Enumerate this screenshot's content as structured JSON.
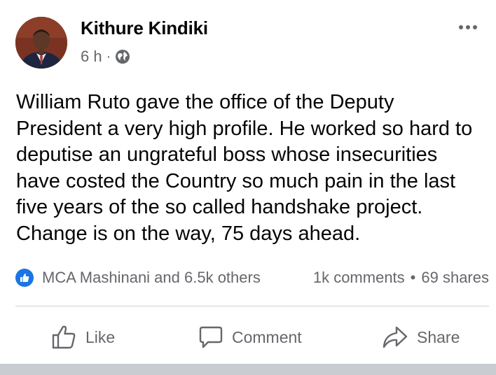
{
  "post": {
    "author": "Kithure Kindiki",
    "time": "6 h",
    "separator": "·",
    "text": "William Ruto gave the office of the Deputy\nPresident a very high profile. He worked so hard to\ndeputise an ungrateful boss whose insecurities\nhave costed the Country so much pain in the last\nfive years of the so called handshake project.\nChange is on the way, 75 days ahead."
  },
  "stats": {
    "reactions": "MCA Mashinani and 6.5k others",
    "comments": "1k comments",
    "bullet": "•",
    "shares": "69 shares"
  },
  "actions": {
    "like": "Like",
    "comment": "Comment",
    "share": "Share"
  },
  "colors": {
    "text": "#050505",
    "secondary": "#65676b",
    "like_blue": "#1b74e4",
    "divider": "#ced0d4"
  },
  "icons": {
    "privacy": "globe-icon",
    "reaction": "thumbs-up-icon",
    "more": "more-options-icon"
  }
}
